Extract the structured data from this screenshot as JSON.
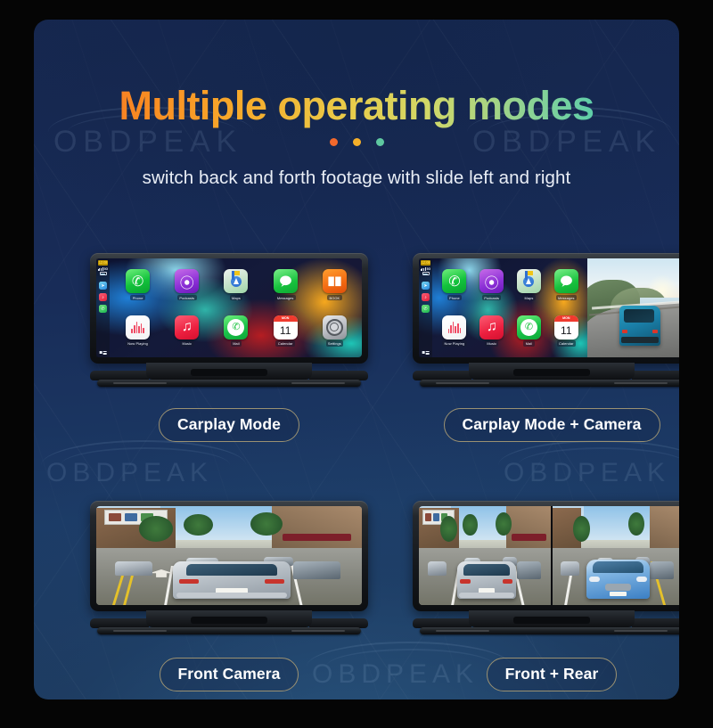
{
  "header": {
    "title": "Multiple operating modes",
    "subtitle": "switch back and forth footage with slide left and right",
    "dots": [
      "#f2692c",
      "#f5b02a",
      "#5ec8a0"
    ]
  },
  "watermark": {
    "text": "OBDPEAK"
  },
  "carplay": {
    "status": {
      "time": "12:08",
      "network": "5G",
      "battery": "battery-icon"
    },
    "dock": [
      "maps",
      "music",
      "phone"
    ],
    "apps_row1": [
      {
        "label": "Phone",
        "icon": "phone"
      },
      {
        "label": "Podcasts",
        "icon": "podcasts"
      },
      {
        "label": "Maps",
        "icon": "maps"
      },
      {
        "label": "Messages",
        "icon": "messages"
      },
      {
        "label": "BOOK",
        "icon": "book"
      }
    ],
    "apps_row2": [
      {
        "label": "Now Playing",
        "icon": "nowplaying"
      },
      {
        "label": "Music",
        "icon": "music"
      },
      {
        "label": "Mail",
        "icon": "mail"
      },
      {
        "label": "Calendar",
        "icon": "calendar",
        "cal_month": "MON",
        "cal_day": "11"
      },
      {
        "label": "Settings",
        "icon": "settings"
      }
    ]
  },
  "modes": [
    {
      "id": "carplay-mode",
      "label": "Carplay Mode",
      "screen": "carplay-full"
    },
    {
      "id": "carplay-mode-camera",
      "label": "Carplay Mode + Camera",
      "screen": "carplay-split-camera"
    },
    {
      "id": "front-camera",
      "label": "Front Camera",
      "screen": "street-full"
    },
    {
      "id": "front-rear",
      "label": "Front + Rear",
      "screen": "street-split"
    }
  ],
  "colors": {
    "panel_top": "#16274f",
    "panel_bottom": "#1b3557",
    "pill_border": "#9a9172",
    "title_gradient_start": "#f4622a",
    "title_gradient_end": "#3fc9bb"
  }
}
